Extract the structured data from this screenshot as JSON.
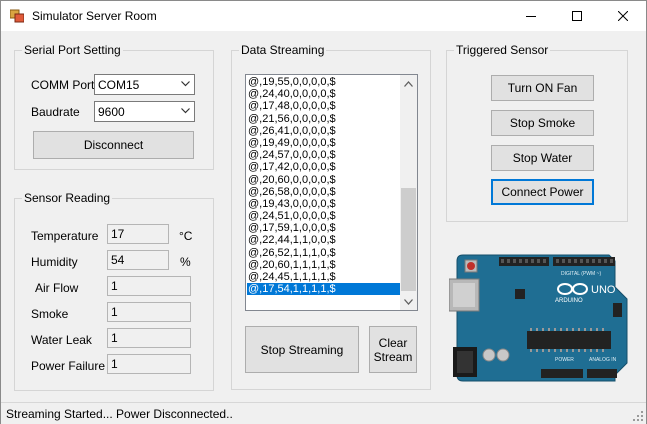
{
  "window": {
    "title": "Simulator Server Room"
  },
  "serial": {
    "group_title": "Serial Port Setting",
    "comm_label": "COMM Port",
    "comm_value": "COM15",
    "baud_label": "Baudrate",
    "baud_value": "9600",
    "disconnect_label": "Disconnect"
  },
  "sensor": {
    "group_title": "Sensor Reading",
    "temperature_label": "Temperature",
    "temperature_value": "17",
    "temperature_unit": "°C",
    "humidity_label": "Humidity",
    "humidity_value": "54",
    "humidity_unit": "%",
    "airflow_label": "Air Flow",
    "airflow_value": "1",
    "smoke_label": "Smoke",
    "smoke_value": "1",
    "water_label": "Water Leak",
    "water_value": "1",
    "power_label": "Power Failure",
    "power_value": "1"
  },
  "stream": {
    "group_title": "Data Streaming",
    "items": [
      "@,19,55,0,0,0,0,$",
      "@,24,40,0,0,0,0,$",
      "@,17,48,0,0,0,0,$",
      "@,21,56,0,0,0,0,$",
      "@,26,41,0,0,0,0,$",
      "@,19,49,0,0,0,0,$",
      "@,24,57,0,0,0,0,$",
      "@,17,42,0,0,0,0,$",
      "@,20,60,0,0,0,0,$",
      "@,26,58,0,0,0,0,$",
      "@,19,43,0,0,0,0,$",
      "@,24,51,0,0,0,0,$",
      "@,17,59,1,0,0,0,$",
      "@,22,44,1,1,0,0,$",
      "@,26,52,1,1,1,0,$",
      "@,20,60,1,1,1,1,$",
      "@,24,45,1,1,1,1,$",
      "@,17,54,1,1,1,1,$"
    ],
    "selected_index": 17,
    "stop_label": "Stop Streaming",
    "clear_label_line1": "Clear",
    "clear_label_line2": "Stream"
  },
  "triggered": {
    "group_title": "Triggered Sensor",
    "fan_label": "Turn ON Fan",
    "smoke_label": "Stop Smoke",
    "water_label": "Stop Water",
    "power_label": "Connect Power"
  },
  "status": {
    "text": "Streaming Started...  Power Disconnected.."
  },
  "arduino": {
    "brand": "ARDUINO",
    "model": "UNO",
    "digital_label": "DIGITAL (PWM ~)",
    "power_label": "POWER",
    "analog_label": "ANALOG IN"
  },
  "colors": {
    "accent": "#0078d7",
    "board": "#1f6e93"
  },
  "icons": [
    "app-icon",
    "minimize-icon",
    "maximize-icon",
    "close-icon",
    "chevron-down-icon",
    "scroll-up-icon",
    "scroll-down-icon",
    "resize-grip-icon"
  ]
}
